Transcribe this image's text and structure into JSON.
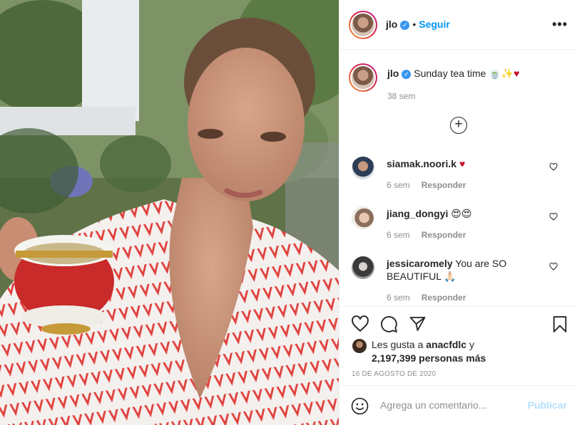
{
  "header": {
    "username": "jlo",
    "separator": "•",
    "follow_label": "Seguir",
    "more_label": "•••"
  },
  "caption": {
    "username": "jlo",
    "text": "Sunday tea time 🍵✨",
    "heart": "♥",
    "time": "38 sem"
  },
  "load_more_label": "+",
  "comments": [
    {
      "username": "siamak.noori.k",
      "text": "",
      "heart": "♥",
      "time": "6 sem",
      "reply_label": "Responder"
    },
    {
      "username": "jiang_dongyi",
      "text": "😍😍",
      "time": "6 sem",
      "reply_label": "Responder"
    },
    {
      "username": "jessicaromely",
      "text": "You are SO BEAUTIFUL 🙏🏻",
      "time": "6 sem",
      "reply_label": "Responder"
    }
  ],
  "likes": {
    "prefix": "Les gusta a",
    "user": "anacfdlc",
    "suffix": "y",
    "count_text": "2,197,399 personas más"
  },
  "date": "16 DE AGOSTO DE 2020",
  "add_comment": {
    "placeholder": "Agrega un comentario...",
    "publish_label": "Publicar"
  },
  "icons": [
    "heart-icon",
    "comment-icon",
    "share-icon",
    "bookmark-icon",
    "emoji-icon",
    "verified-icon",
    "more-icon",
    "plus-circle-icon"
  ],
  "colors": {
    "link": "#0095f6",
    "verified": "#3897f0",
    "muted": "#8e8e8e",
    "publish_disabled": "#b2dffc"
  }
}
